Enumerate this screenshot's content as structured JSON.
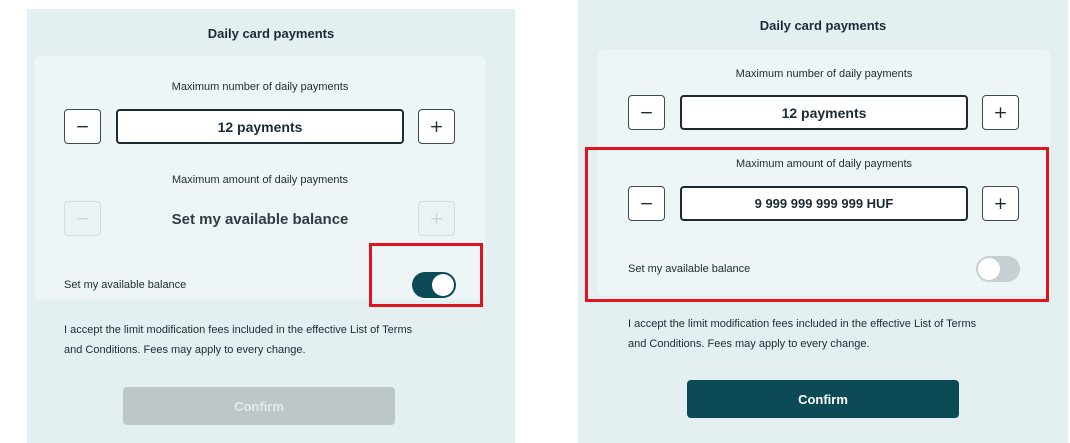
{
  "left": {
    "title": "Daily card payments",
    "count_label": "Maximum number of daily payments",
    "count_value": "12 payments",
    "amount_label": "Maximum amount of daily payments",
    "amount_value": "Set my available balance",
    "toggle_label": "Set my available balance",
    "toggle_state": "on",
    "terms_line1": "I accept the limit modification fees included in the effective List of Terms",
    "terms_line2": "and Conditions. Fees may apply to every change.",
    "confirm_label": "Confirm",
    "confirm_state": "disabled"
  },
  "right": {
    "title": "Daily card payments",
    "count_label": "Maximum number of daily payments",
    "count_value": "12 payments",
    "amount_label": "Maximum amount of daily payments",
    "amount_value": "9 999 999 999 999 HUF",
    "toggle_label": "Set my available balance",
    "toggle_state": "off",
    "terms_line1": "I accept the limit modification fees included in the effective List of Terms",
    "terms_line2": "and Conditions. Fees may apply to every change.",
    "confirm_label": "Confirm",
    "confirm_state": "active"
  },
  "icons": {
    "decrement": "minus-icon",
    "increment": "plus-icon"
  },
  "symbols": {
    "minus": "−",
    "plus": "+"
  },
  "colors": {
    "accent": "#0c4b56",
    "highlight": "#e0141e",
    "panel_bg": "#e4eff1",
    "disabled_button": "#bdc6c8"
  }
}
